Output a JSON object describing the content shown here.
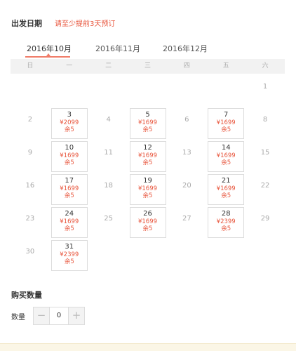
{
  "date_section": {
    "title": "出发日期",
    "notice": "请至少提前3天预订"
  },
  "month_tabs": [
    {
      "label": "2016年10月",
      "active": true
    },
    {
      "label": "2016年11月",
      "active": false
    },
    {
      "label": "2016年12月",
      "active": false
    }
  ],
  "weekdays": [
    "日",
    "一",
    "二",
    "三",
    "四",
    "五",
    "六"
  ],
  "calendar": [
    [
      null,
      null,
      null,
      null,
      null,
      null,
      {
        "day": "1"
      }
    ],
    [
      {
        "day": "2"
      },
      {
        "day": "3",
        "price": "¥2099",
        "stock": "余5"
      },
      {
        "day": "4"
      },
      {
        "day": "5",
        "price": "¥1699",
        "stock": "余5"
      },
      {
        "day": "6"
      },
      {
        "day": "7",
        "price": "¥1699",
        "stock": "余5"
      },
      {
        "day": "8"
      }
    ],
    [
      {
        "day": "9"
      },
      {
        "day": "10",
        "price": "¥1699",
        "stock": "余5"
      },
      {
        "day": "11"
      },
      {
        "day": "12",
        "price": "¥1699",
        "stock": "余5"
      },
      {
        "day": "13"
      },
      {
        "day": "14",
        "price": "¥1699",
        "stock": "余5"
      },
      {
        "day": "15"
      }
    ],
    [
      {
        "day": "16"
      },
      {
        "day": "17",
        "price": "¥1699",
        "stock": "余5"
      },
      {
        "day": "18"
      },
      {
        "day": "19",
        "price": "¥1699",
        "stock": "余5"
      },
      {
        "day": "20"
      },
      {
        "day": "21",
        "price": "¥1699",
        "stock": "余5"
      },
      {
        "day": "22"
      }
    ],
    [
      {
        "day": "23"
      },
      {
        "day": "24",
        "price": "¥1699",
        "stock": "余5"
      },
      {
        "day": "25"
      },
      {
        "day": "26",
        "price": "¥1699",
        "stock": "余5"
      },
      {
        "day": "27"
      },
      {
        "day": "28",
        "price": "¥2399",
        "stock": "余5"
      },
      {
        "day": "29"
      }
    ],
    [
      {
        "day": "30"
      },
      {
        "day": "31",
        "price": "¥2399",
        "stock": "余5"
      },
      null,
      null,
      null,
      null,
      null
    ]
  ],
  "quantity_section": {
    "title": "购买数量",
    "label": "数量",
    "value": "0",
    "minus": "−",
    "plus": "+"
  },
  "colors": {
    "accent": "#e8553c",
    "tab_underline": "#f07c69"
  }
}
